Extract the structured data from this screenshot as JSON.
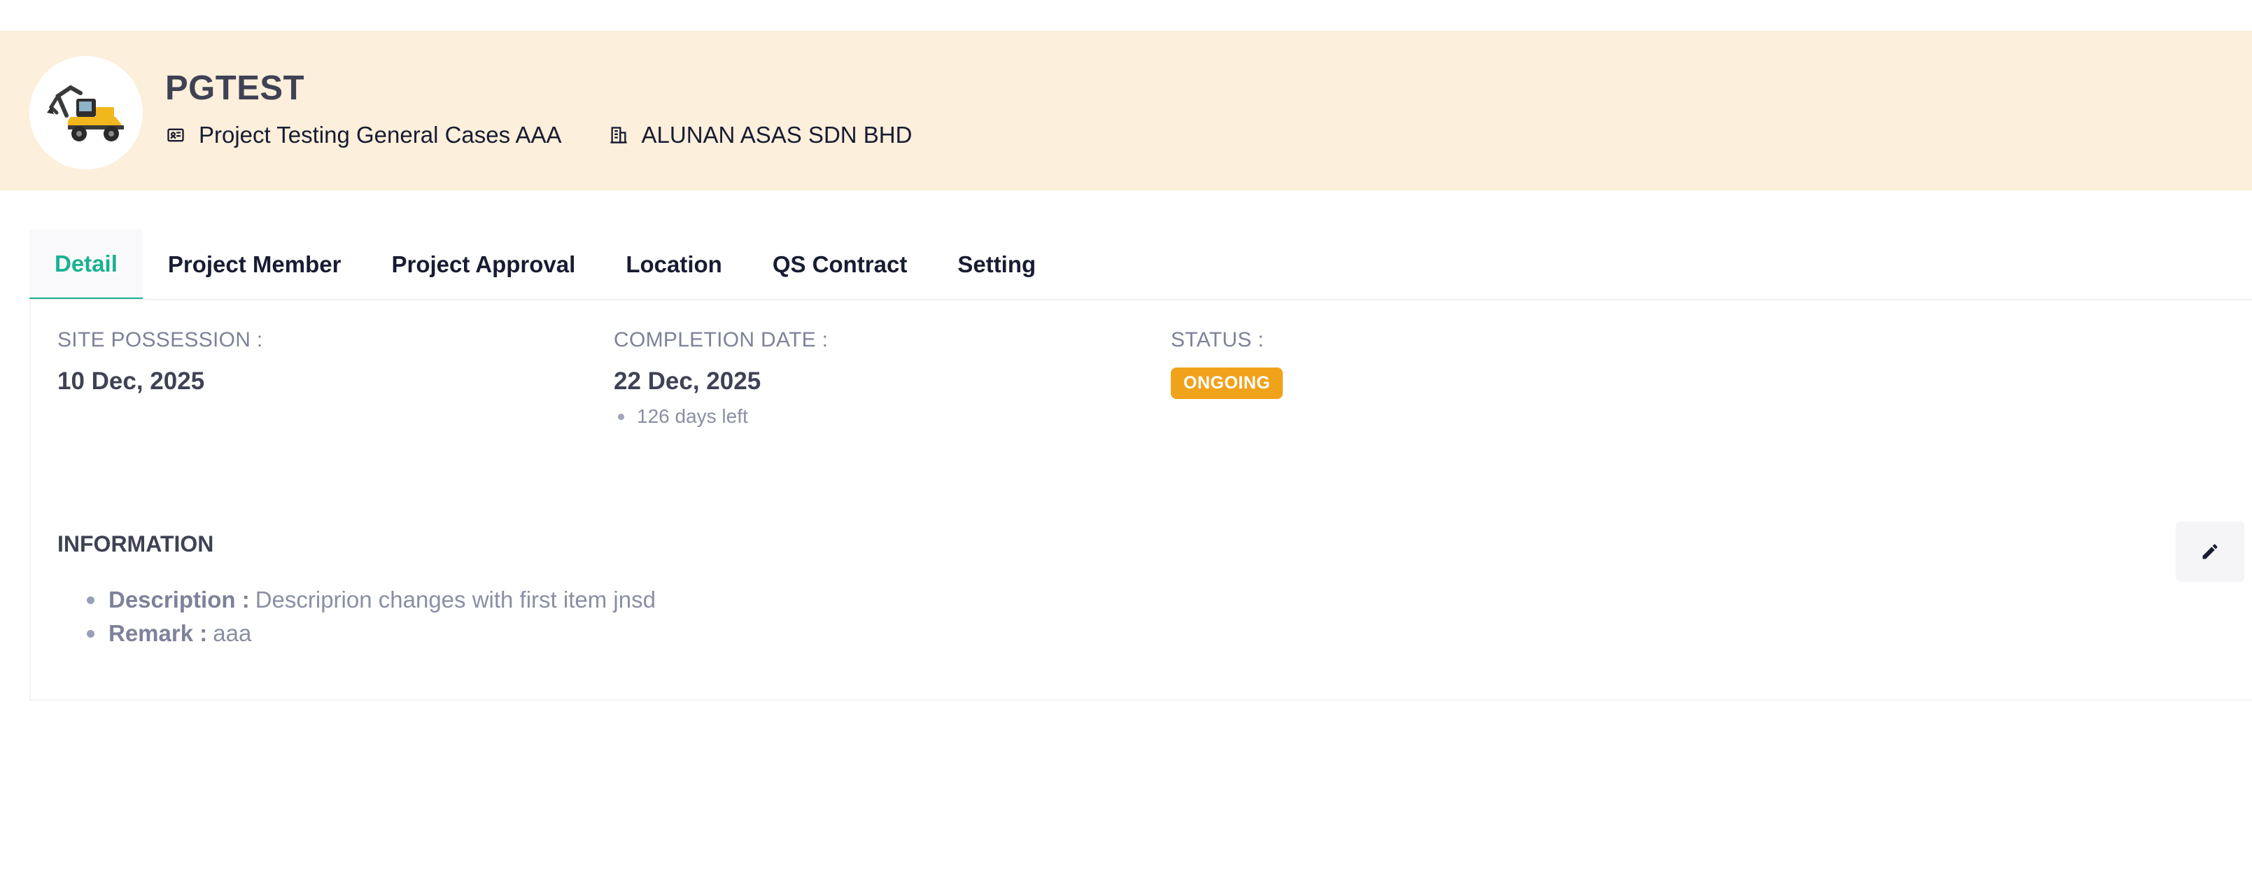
{
  "header": {
    "project_code": "PGTEST",
    "project_name": "Project Testing General Cases AAA",
    "company_name": "ALUNAN ASAS SDN BHD",
    "project_icon": "project-card-icon",
    "company_icon": "building-icon",
    "avatar": "excavator-image",
    "background_color": "#fcefdb"
  },
  "tabs": [
    {
      "label": "Detail",
      "active": true
    },
    {
      "label": "Project Member",
      "active": false
    },
    {
      "label": "Project Approval",
      "active": false
    },
    {
      "label": "Location",
      "active": false
    },
    {
      "label": "QS Contract",
      "active": false
    },
    {
      "label": "Setting",
      "active": false
    }
  ],
  "detail": {
    "site_possession": {
      "label": "SITE POSSESSION :",
      "value": "10 Dec, 2025"
    },
    "completion_date": {
      "label": "COMPLETION DATE :",
      "value": "22 Dec, 2025",
      "sub": "126 days left"
    },
    "status": {
      "label": "STATUS :",
      "value": "ONGOING",
      "color": "#f1a21b"
    }
  },
  "information": {
    "title": "INFORMATION",
    "items": [
      {
        "key": "Description :",
        "value": "Descriprion changes with first item jnsd"
      },
      {
        "key": "Remark :",
        "value": "aaa"
      }
    ]
  },
  "actions": {
    "edit_icon": "pencil-icon"
  },
  "colors": {
    "accent": "#1bb191",
    "status_ongoing": "#f1a21b"
  }
}
